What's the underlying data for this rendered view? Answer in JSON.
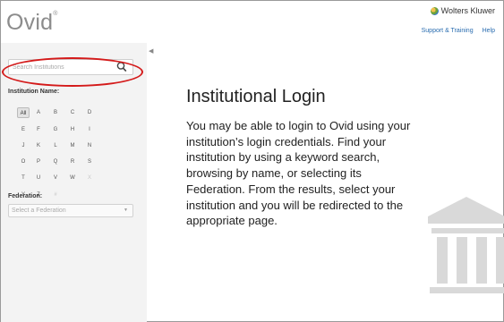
{
  "header": {
    "logo": "Ovid",
    "logo_mark": "®",
    "brand": "Wolters Kluwer",
    "links": [
      "Support & Training",
      "Help"
    ]
  },
  "sidebar": {
    "collapse_glyph": "◀",
    "search_placeholder": "Search Institutions",
    "institution_label": "Institution Name:",
    "letters": [
      "All",
      "A",
      "B",
      "C",
      "D",
      "E",
      "F",
      "G",
      "H",
      "I",
      "J",
      "K",
      "L",
      "M",
      "N",
      "O",
      "P",
      "Q",
      "R",
      "S",
      "T",
      "U",
      "V",
      "W",
      "X",
      "Y",
      "Z",
      "#"
    ],
    "disabled_letters": [
      "X",
      "#"
    ],
    "federation_label": "Federation:",
    "federation_placeholder": "Select a Federation"
  },
  "main": {
    "title": "Institutional Login",
    "body": "You may be able to login to Ovid using your institution’s login credentials. Find your institution by using a keyword search, browsing by name, or selecting its Federation. From the results, select your institution and you will be redirected to the appropriate page."
  },
  "icons": {
    "search": "search-icon",
    "brand": "wolters-kluwer-logo-icon",
    "institution": "institution-building-icon"
  },
  "colors": {
    "link": "#2a6db0",
    "highlight": "#d41a1a",
    "sidebar_bg": "#f3f3f3"
  }
}
